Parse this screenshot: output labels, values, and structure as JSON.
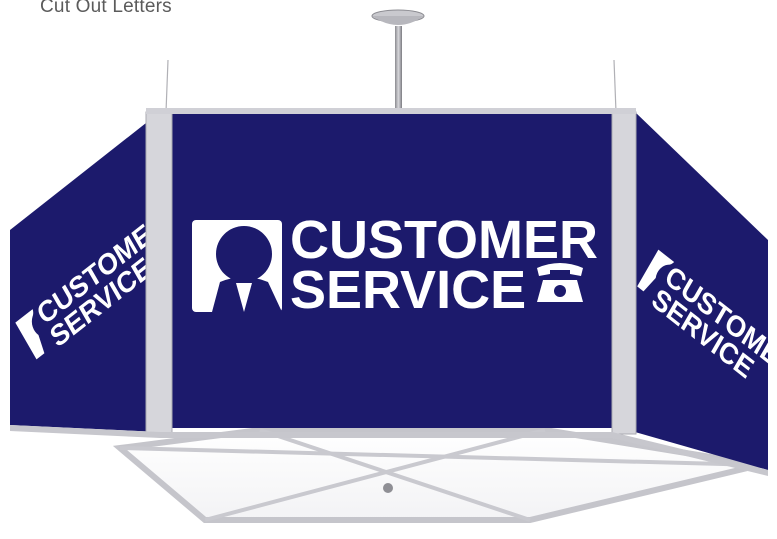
{
  "caption": "Cut Out Letters",
  "sign": {
    "line1": "CUSTOMER",
    "line2": "SERVICE",
    "panel_color": "#1c1a6c",
    "frame_color": "#d6d6db",
    "letter_color": "#ffffff"
  },
  "icons": [
    "person-icon",
    "telephone-icon"
  ]
}
